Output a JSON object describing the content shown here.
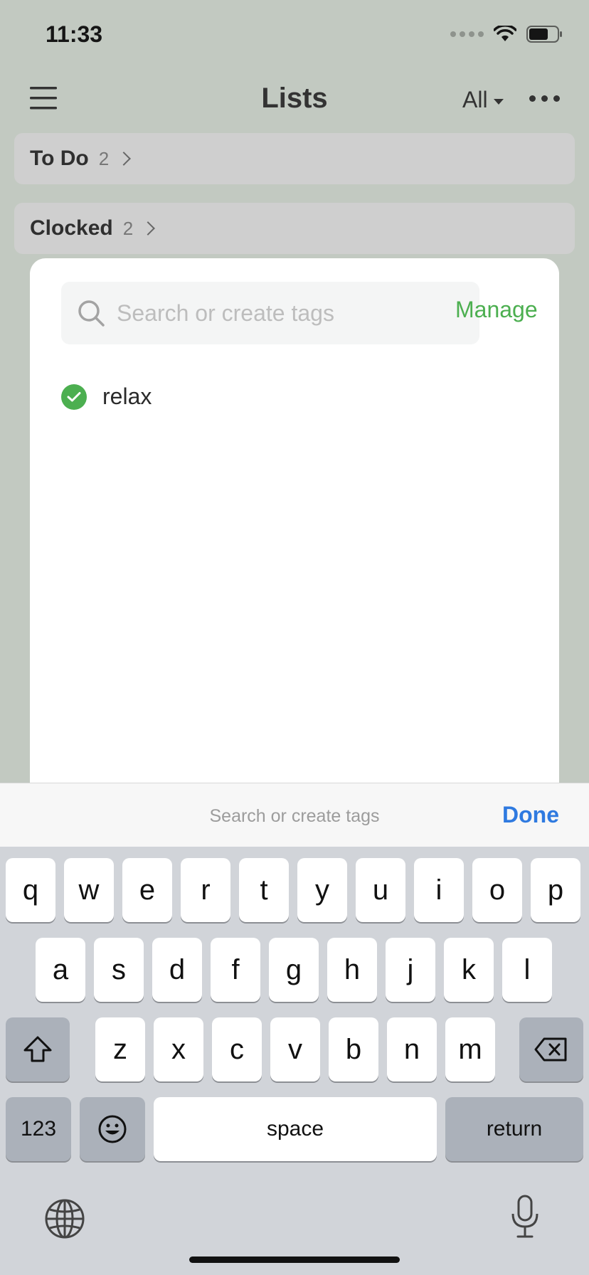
{
  "status_bar": {
    "time": "11:33"
  },
  "nav": {
    "title": "Lists",
    "filter_label": "All"
  },
  "lists": [
    {
      "label": "To Do",
      "count": "2"
    },
    {
      "label": "Clocked",
      "count": "2"
    }
  ],
  "tag_sheet": {
    "search_placeholder": "Search or create tags",
    "manage_label": "Manage",
    "tags": [
      {
        "label": "relax",
        "selected": true
      }
    ]
  },
  "accessory": {
    "hint": "Search or create tags",
    "done_label": "Done"
  },
  "keyboard": {
    "row1": [
      "q",
      "w",
      "e",
      "r",
      "t",
      "y",
      "u",
      "i",
      "o",
      "p"
    ],
    "row2": [
      "a",
      "s",
      "d",
      "f",
      "g",
      "h",
      "j",
      "k",
      "l"
    ],
    "row3": [
      "z",
      "x",
      "c",
      "v",
      "b",
      "n",
      "m"
    ],
    "numbers_label": "123",
    "space_label": "space",
    "return_label": "return"
  },
  "colors": {
    "accent_green": "#4caf50",
    "done_blue": "#2f7ae0"
  }
}
